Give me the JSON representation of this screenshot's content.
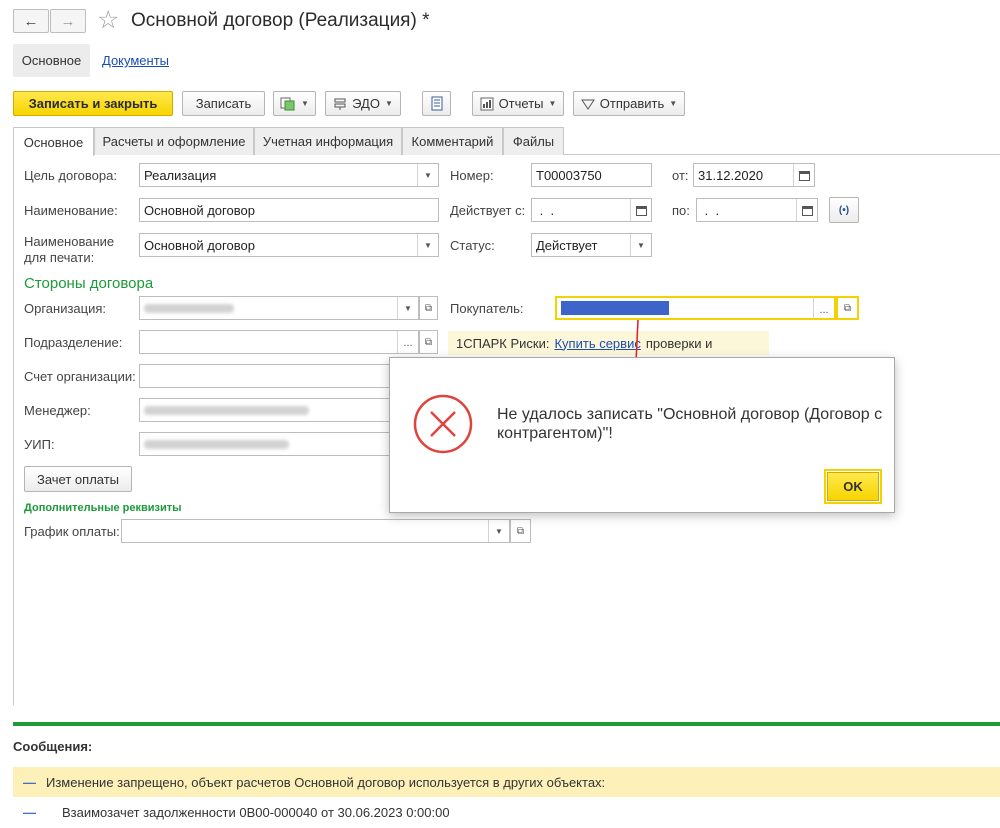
{
  "window": {
    "title": "Основной договор (Реализация) *",
    "back_glyph": "←",
    "forward_glyph": "→",
    "star_glyph": "☆"
  },
  "sections": {
    "main": "Основное",
    "documents": "Документы"
  },
  "toolbar": {
    "save_close": "Записать и закрыть",
    "save": "Записать",
    "edo": "ЭДО",
    "reports": "Отчеты",
    "send": "Отправить"
  },
  "tabs": [
    "Основное",
    "Расчеты и оформление",
    "Учетная информация",
    "Комментарий",
    "Файлы"
  ],
  "form": {
    "purpose_label": "Цель договора:",
    "purpose_value": "Реализация",
    "name_label": "Наименование:",
    "name_value": "Основной договор",
    "print_name_label_1": "Наименование",
    "print_name_label_2": "для печати:",
    "print_name_value": "Основной договор",
    "number_label": "Номер:",
    "number_value": "Т00003750",
    "date_from_label": "от:",
    "date_value": "31.12.2020",
    "valid_from_label": "Действует с:",
    "valid_from_value": " .  .",
    "valid_to_label": "по:",
    "valid_to_value": " .  .",
    "status_label": "Статус:",
    "status_value": "Действует",
    "parties_heading": "Стороны договора",
    "org_label": "Организация:",
    "buyer_label": "Покупатель:",
    "division_label": "Подразделение:",
    "spark_prefix": "1СПАРК Риски:",
    "spark_link": "Купить сервис",
    "spark_suffix": "проверки и",
    "account_label": "Счет организации:",
    "manager_label": "Менеджер:",
    "uip_label": "УИП:",
    "offset_button": "Зачет оплаты",
    "extra_heading": "Дополнительные реквизиты",
    "schedule_label": "График оплаты:"
  },
  "dialog": {
    "message": "Не удалось записать \"Основной договор (Договор с контрагентом)\"!",
    "ok": "OK"
  },
  "messages": {
    "title": "Сообщения:",
    "items": [
      "Изменение запрещено, объект расчетов Основной договор используется в других объектах:",
      "Взаимозачет задолженности 0В00-000040 от 30.06.2023 0:00:00"
    ]
  },
  "colors": {
    "accent_yellow": "#f7d400",
    "green": "#1d9a3a",
    "link": "#1a4db3",
    "error_red": "#e0433c",
    "message_highlight": "#fdf0b8"
  }
}
